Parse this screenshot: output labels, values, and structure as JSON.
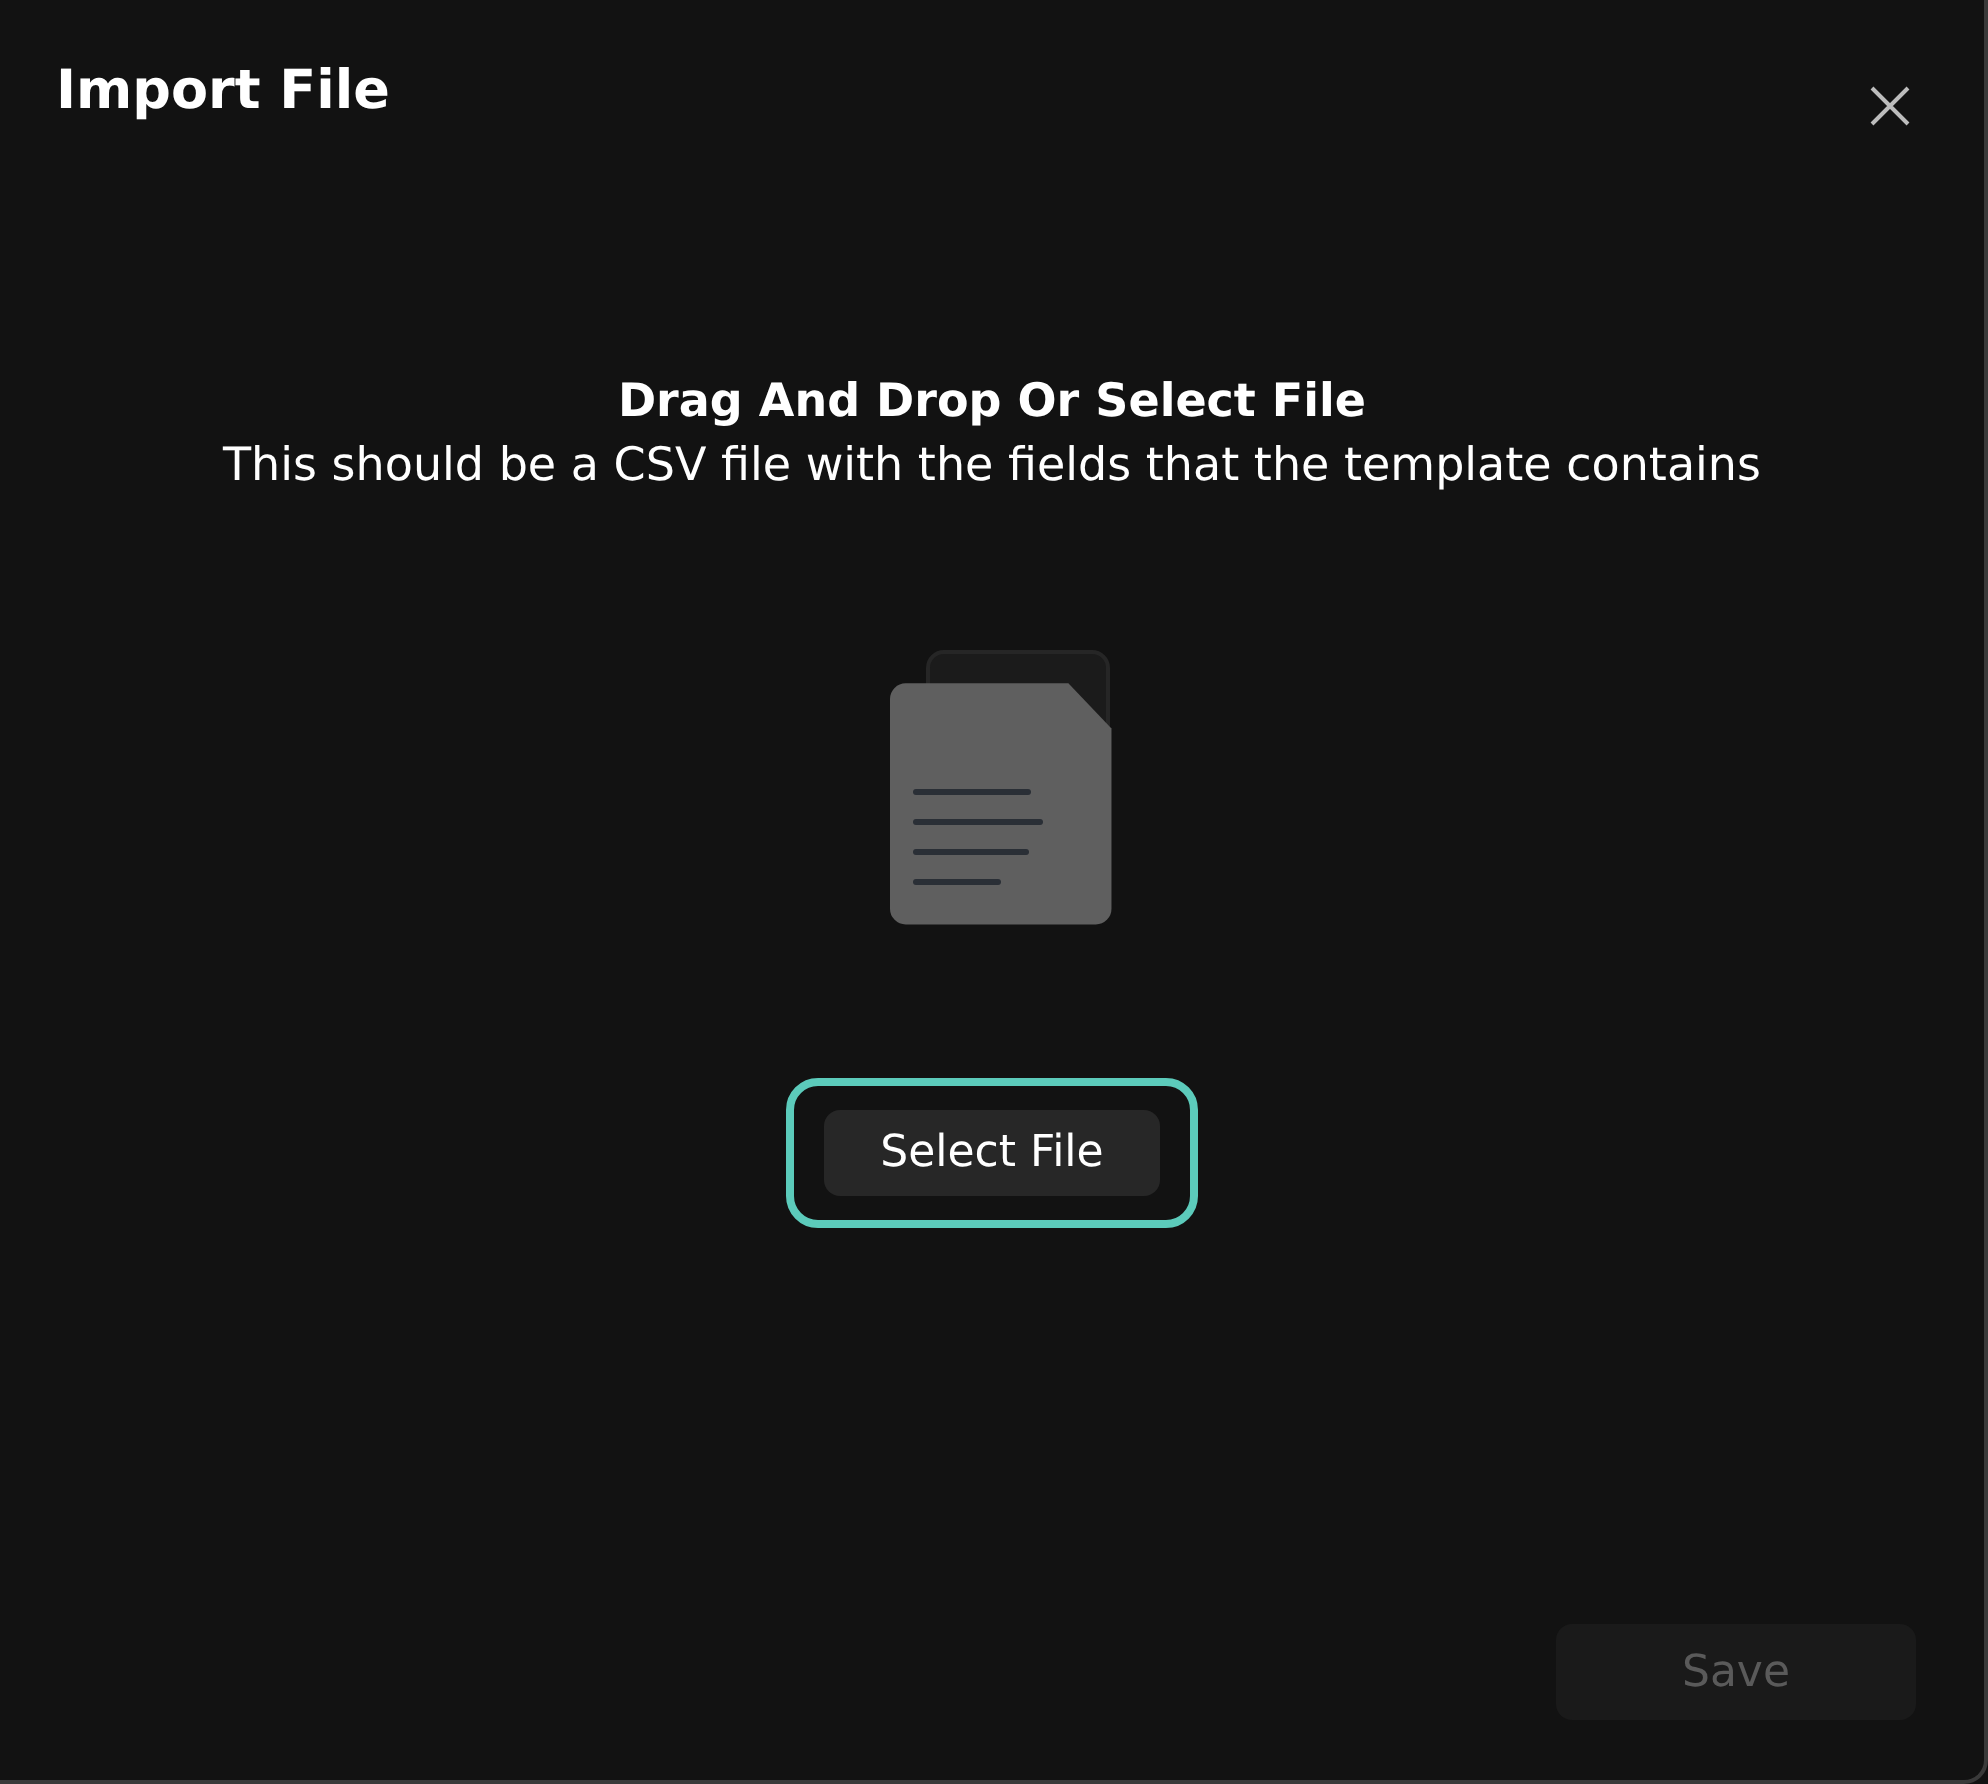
{
  "dialog": {
    "title": "Import File"
  },
  "dropzone": {
    "heading": "Drag And Drop Or Select File",
    "description": "This should be a CSV file with the fields that the template contains"
  },
  "select_button": {
    "label": "Select File",
    "focused": true
  },
  "save_button": {
    "label": "Save",
    "disabled": true
  }
}
